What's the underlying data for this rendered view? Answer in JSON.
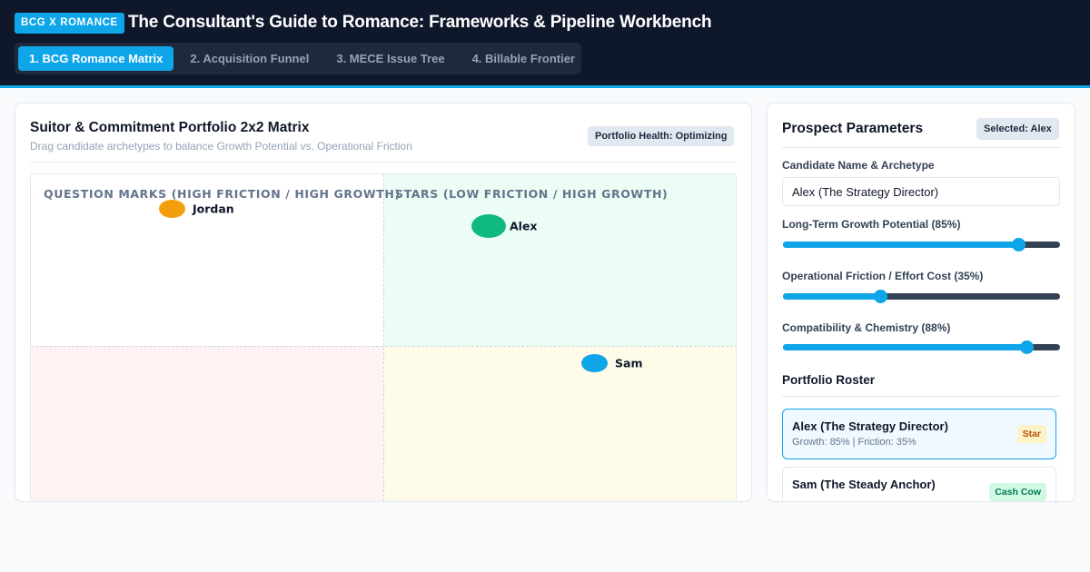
{
  "header": {
    "badge": "BCG X ROMANCE",
    "title": "The Consultant's Guide to Romance: Frameworks & Pipeline Workbench",
    "tabs": [
      {
        "label": "1. BCG Romance Matrix",
        "active": true
      },
      {
        "label": "2. Acquisition Funnel",
        "active": false
      },
      {
        "label": "3. MECE Issue Tree",
        "active": false
      },
      {
        "label": "4. Billable Frontier",
        "active": false
      }
    ]
  },
  "matrix_panel": {
    "title": "Suitor & Commitment Portfolio 2x2 Matrix",
    "subtitle": "Drag candidate archetypes to balance Growth Potential vs. Operational Friction",
    "health_badge": "Portfolio Health: Optimizing",
    "quadrant_labels": {
      "top_left": "QUESTION MARKS (HIGH FRICTION / HIGH GROWTH)",
      "top_right": "STARS (LOW FRICTION / HIGH GROWTH)"
    },
    "suitors": [
      {
        "name": "Jordan",
        "color": "#f59e0b"
      },
      {
        "name": "Alex",
        "color": "#10b981"
      },
      {
        "name": "Sam",
        "color": "#0ea5e9"
      }
    ]
  },
  "parameters_panel": {
    "title": "Prospect Parameters",
    "selected_badge": "Selected: Alex",
    "name_label": "Candidate Name & Archetype",
    "name_value": "Alex (The Strategy Director)",
    "sliders": [
      {
        "label": "Long-Term Growth Potential (85%)",
        "value": 85
      },
      {
        "label": "Operational Friction / Effort Cost (35%)",
        "value": 35
      },
      {
        "label": "Compatibility & Chemistry (88%)",
        "value": 88
      }
    ],
    "roster_title": "Portfolio Roster",
    "roster": [
      {
        "name": "Alex (The Strategy Director)",
        "meta": "Growth: 85% | Friction: 35%",
        "tag": "Star",
        "tag_bg": "#fef3c7",
        "tag_color": "#b45309",
        "selected": true
      },
      {
        "name": "Sam (The Steady Anchor)",
        "meta": "",
        "tag": "Cash Cow",
        "tag_bg": "#d1fae5",
        "tag_color": "#047857",
        "selected": false
      }
    ]
  },
  "colors": {
    "accent": "#0ea5e9",
    "header_bg": "#0f172a"
  }
}
